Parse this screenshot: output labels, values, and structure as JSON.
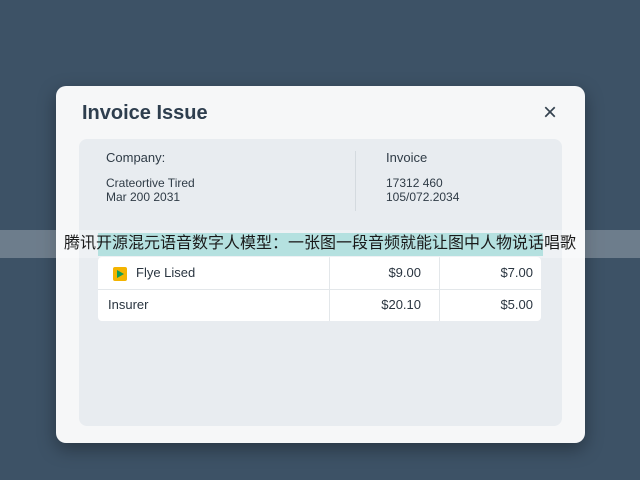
{
  "dialog": {
    "title": "Invoice Issue",
    "close_label": "×"
  },
  "details": {
    "company_label": "Company:",
    "company_name": "Crateortive Tired",
    "company_date": "Mar 200 2031",
    "invoice_label": "Invoice",
    "invoice_number": "17312 460",
    "invoice_date": "105/072.2034"
  },
  "table": {
    "rows": [
      {
        "name": "Flye Lised",
        "amount": "$9.00",
        "tax": "$7.00",
        "icon": "file-icon"
      },
      {
        "name": "Insurer",
        "amount": "$20.10",
        "tax": "$5.00"
      }
    ]
  },
  "banner": {
    "text": "腾讯开源混元语音数字人模型：一张图一段音频就能让图中人物说话唱歌"
  },
  "colors": {
    "background": "#3d5266",
    "dialog": "#f6f7f8",
    "panel": "#e8ecf0",
    "banner_highlight": "#aadedc"
  }
}
